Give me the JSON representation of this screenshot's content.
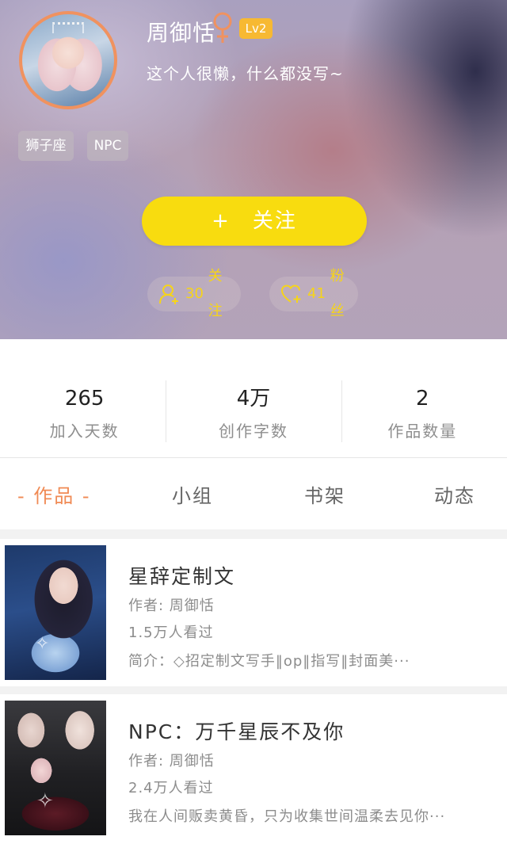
{
  "profile": {
    "username": "周御恬",
    "gender_symbol": "♀",
    "level": "Lv2",
    "bio": "这个人很懒，什么都没写~",
    "tags": [
      "狮子座",
      "NPC"
    ],
    "follow_button_plus": "+",
    "follow_button_label": "关注",
    "following_count": "30",
    "following_label": "关注",
    "fans_count": "41",
    "fans_label": "粉丝"
  },
  "stats": [
    {
      "value": "265",
      "label": "加入天数"
    },
    {
      "value": "4万",
      "label": "创作字数"
    },
    {
      "value": "2",
      "label": "作品数量"
    }
  ],
  "tabs": [
    {
      "label": "- 作品 -",
      "active": true
    },
    {
      "label": "小组",
      "active": false
    },
    {
      "label": "书架",
      "active": false
    },
    {
      "label": "动态",
      "active": false
    }
  ],
  "works": [
    {
      "title": "星辞定制文",
      "author": "作者: 周御恬",
      "views": "1.5万人看过",
      "summary": "简介：◇招定制文写手‖op‖指写‖封面美···"
    },
    {
      "title": "NPC：万千星辰不及你",
      "author": "作者: 周御恬",
      "views": "2.4万人看过",
      "summary": "我在人间贩卖黄昏，只为收集世间温柔去见你···"
    }
  ],
  "colors": {
    "accent_orange": "#f08a54",
    "follow_yellow": "#f8dc0f",
    "level_badge": "#f7b932",
    "female_symbol": "#f0925f",
    "stat_highlight": "#f6d41a"
  },
  "icons": [
    "female-icon",
    "add-user-icon",
    "heart-plus-icon"
  ]
}
